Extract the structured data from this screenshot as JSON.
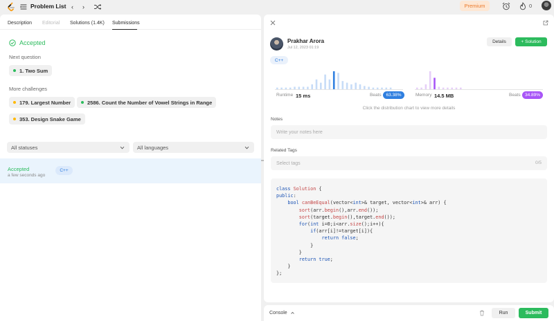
{
  "topbar": {
    "title": "Problem List",
    "premium_label": "Premium",
    "streak_count": "0",
    "icons": [
      "leetcode-logo-icon",
      "list-icon",
      "chevron-left-icon",
      "chevron-right-icon",
      "shuffle-icon",
      "alarm-icon",
      "fire-icon",
      "avatar"
    ]
  },
  "left": {
    "tabs": [
      {
        "label": "Description"
      },
      {
        "label": "Editorial"
      },
      {
        "label": "Solutions (1.4K)"
      },
      {
        "label": "Submissions"
      }
    ],
    "accepted_label": "Accepted",
    "next_question_label": "Next question",
    "next_question": {
      "label": "1. Two Sum",
      "color": "#2cbb5d"
    },
    "more_challenges_label": "More challenges",
    "challenges": [
      {
        "label": "179. Largest Number",
        "color": "#ffb800"
      },
      {
        "label": "2586. Count the Number of Vowel Strings in Range",
        "color": "#2cbb5d"
      },
      {
        "label": "353. Design Snake Game",
        "color": "#ffb800"
      }
    ],
    "filters": {
      "status": "All statuses",
      "language": "All languages"
    },
    "submission": {
      "status": "Accepted",
      "time": "a few seconds ago",
      "language": "C++"
    }
  },
  "right": {
    "author": "Prakhar Arora",
    "date": "Jul 12, 2023 01:19",
    "details_label": "Details",
    "solution_label": "Solution",
    "language": "C++",
    "runtime": {
      "label": "Runtime",
      "value": "15 ms",
      "beats_label": "Beats",
      "percent": "63.38%",
      "color": "#2f7fe0"
    },
    "memory": {
      "label": "Memory",
      "value": "14.5 MB",
      "beats_label": "Beats",
      "percent": "34.89%",
      "color": "#a855f7"
    },
    "hint": "Click the distribution chart to view more details",
    "notes_label": "Notes",
    "notes_placeholder": "Write your notes here",
    "tags_label": "Related Tags",
    "tags_placeholder": "Select tags",
    "tags_count": "0/5",
    "runtime_distribution": [
      2,
      2,
      2,
      2,
      3,
      3,
      3,
      3,
      6,
      12,
      8,
      18,
      12,
      22,
      20,
      10,
      8,
      6,
      8,
      6,
      4,
      3,
      2,
      2,
      2,
      2,
      2
    ],
    "runtime_highlight_index": 13,
    "memory_distribution": [
      2,
      2,
      6,
      22,
      14,
      3,
      2,
      2,
      2,
      2,
      2
    ],
    "memory_highlight_index": 4,
    "code_lines": [
      "class Solution {",
      "public:",
      "    bool canBeEqual(vector<int>& target, vector<int>& arr) {",
      "        sort(arr.begin(),arr.end());",
      "        sort(target.begin(),target.end());",
      "        for(int i=0;i<arr.size();i++){",
      "            if(arr[i]!=target[i]){",
      "                return false;",
      "            }",
      "        }",
      "        return true;",
      "    }",
      "};"
    ]
  },
  "bottom": {
    "console_label": "Console",
    "run_label": "Run",
    "submit_label": "Submit"
  }
}
